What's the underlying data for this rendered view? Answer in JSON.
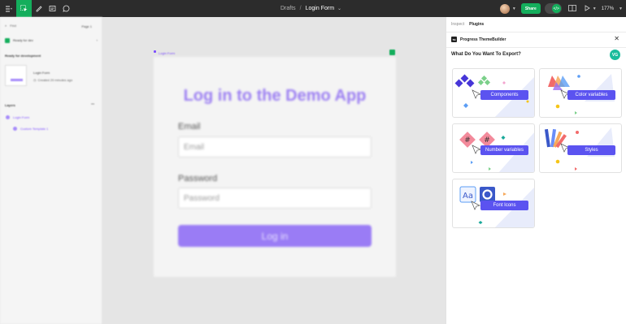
{
  "topbar": {
    "breadcrumb_parent": "Drafts",
    "breadcrumb_separator": "/",
    "file_name": "Login Form",
    "share_label": "Share",
    "dev_mode_label": "</>",
    "zoom_label": "177%"
  },
  "left_sidebar": {
    "search_placeholder": "Find",
    "page_label": "Page 1",
    "ready_chip_label": "Ready for dev",
    "ready_section_title": "Ready for development",
    "ready_item_title": "Login Form",
    "ready_item_meta": "Created 20 minutes ago",
    "layers_title": "Layers",
    "layers": [
      {
        "label": "Login Form"
      },
      {
        "label": "Custom Template 1"
      }
    ]
  },
  "canvas": {
    "frame_label": "Login Form",
    "frame": {
      "title": "Log in to the Demo App",
      "email_label": "Email",
      "email_placeholder": "Email",
      "password_label": "Password",
      "password_placeholder": "Password",
      "login_button": "Log in"
    }
  },
  "right_panel": {
    "tabs": [
      {
        "label": "Inspect",
        "active": false
      },
      {
        "label": "Plugins",
        "active": true
      }
    ],
    "plugin_name": "Progress ThemeBuilder",
    "plugin_logo_text": "TB",
    "close_icon": "close-icon",
    "export_title": "What Do You Want To Export?",
    "user_initials": "VG",
    "cards": [
      {
        "label": "Components"
      },
      {
        "label": "Color variables"
      },
      {
        "label": "Number variables"
      },
      {
        "label": "Styles"
      },
      {
        "label": "Font Icons"
      }
    ]
  },
  "colors": {
    "accent_green": "#14ae5c",
    "brand_purple": "#7c4dff",
    "card_button": "#5b53f0",
    "badge_teal": "#1abc9c"
  }
}
